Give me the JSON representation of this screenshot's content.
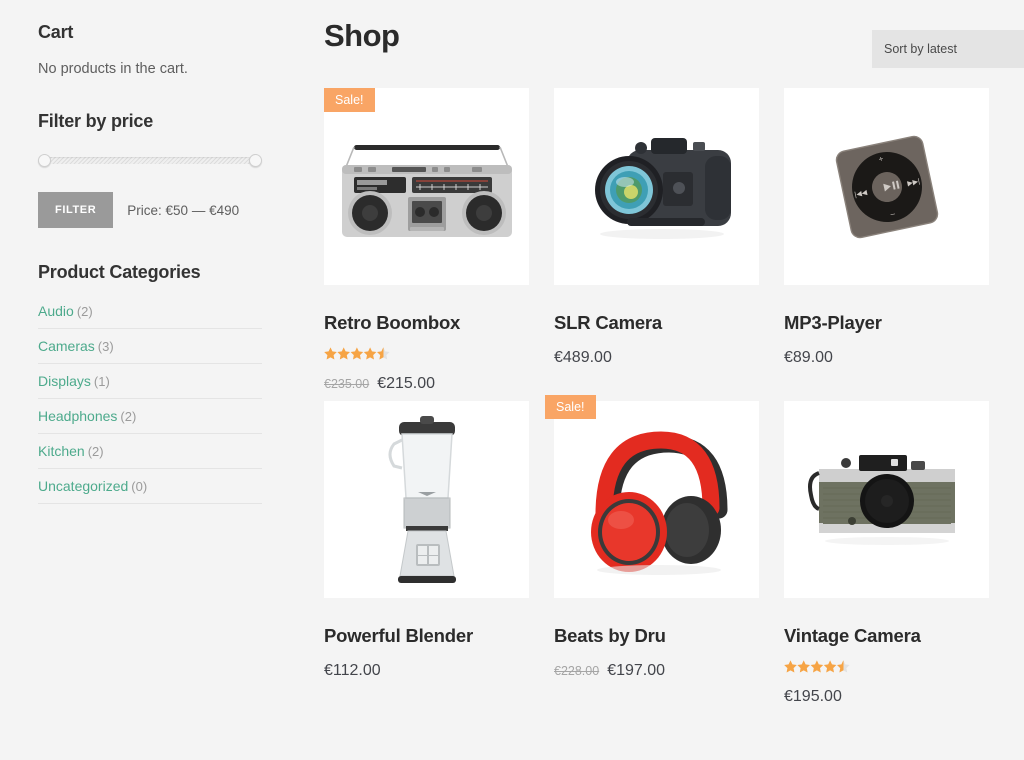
{
  "sidebar": {
    "cart": {
      "title": "Cart",
      "empty_text": "No products in the cart."
    },
    "filter_price": {
      "title": "Filter by price",
      "button_label": "FILTER",
      "price_label": "Price: €50 — €490",
      "min_value": "€50",
      "max_value": "€490"
    },
    "categories": {
      "title": "Product Categories",
      "items": [
        {
          "label": "Audio",
          "count": "(2)"
        },
        {
          "label": "Cameras",
          "count": "(3)"
        },
        {
          "label": "Displays",
          "count": "(1)"
        },
        {
          "label": "Headphones",
          "count": "(2)"
        },
        {
          "label": "Kitchen",
          "count": "(2)"
        },
        {
          "label": "Uncategorized",
          "count": "(0)"
        }
      ]
    }
  },
  "main": {
    "title": "Shop",
    "sort_selected": "Sort by latest",
    "sale_badge_label": "Sale!",
    "products": [
      {
        "name": "Retro Boombox",
        "image": "boombox",
        "on_sale": true,
        "rating": 4.5,
        "price_old": "€235.00",
        "price": "€215.00"
      },
      {
        "name": "SLR Camera",
        "image": "slr-camera",
        "on_sale": false,
        "rating": 0,
        "price_old": "",
        "price": "€489.00"
      },
      {
        "name": "MP3-Player",
        "image": "mp3-player",
        "on_sale": false,
        "rating": 0,
        "price_old": "",
        "price": "€89.00"
      },
      {
        "name": "Powerful Blender",
        "image": "blender",
        "on_sale": false,
        "rating": 0,
        "price_old": "",
        "price": "€112.00"
      },
      {
        "name": "Beats by Dru",
        "image": "headphones",
        "on_sale": true,
        "rating": 0,
        "price_old": "€228.00",
        "price": "€197.00"
      },
      {
        "name": "Vintage Camera",
        "image": "vintage-camera",
        "on_sale": false,
        "rating": 4.5,
        "price_old": "",
        "price": "€195.00"
      }
    ]
  },
  "colors": {
    "accent_link": "#4daa8c",
    "sale_badge": "#f9a565",
    "star": "#f6a445",
    "page_bg": "#f4f4f4",
    "tile_bg": "#ffffff",
    "filter_button": "#9a9a9a"
  }
}
